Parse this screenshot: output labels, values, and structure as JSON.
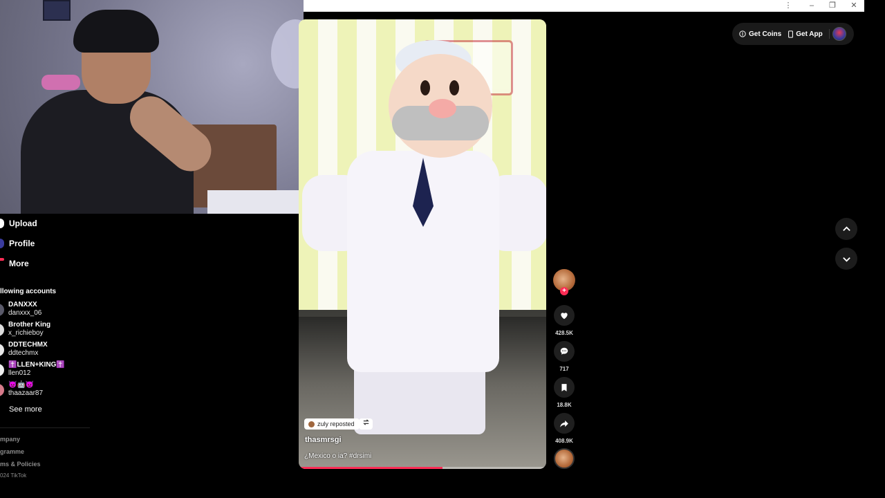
{
  "sidebar": {
    "nav": [
      {
        "label": "Upload",
        "icon": "upload-icon"
      },
      {
        "label": "Profile",
        "icon": "profile-icon"
      },
      {
        "label": "More",
        "icon": "more-icon"
      }
    ],
    "following_title": "llowing accounts",
    "accounts": [
      {
        "name": "DANXXX",
        "username": "danxxx_06"
      },
      {
        "name": "Brother King",
        "username": "x_richieboy"
      },
      {
        "name": "DDTECHMX",
        "username": "ddtechmx"
      },
      {
        "name": "✝️LLEN+KING✝️",
        "username": "llen012"
      },
      {
        "name": "👿🤖👿",
        "username": "thaazaar87"
      }
    ],
    "see_more": "See more",
    "footer": [
      "mpany",
      "gramme",
      "ms & Policies",
      "024 TikTok"
    ]
  },
  "video": {
    "repost_label": "zuly reposted",
    "author": "thasmrsgi",
    "caption": "¿Mexico o ia? #drsimi",
    "progress": 0.58
  },
  "actions": {
    "likes": "428.5K",
    "comments": "717",
    "saves": "18.8K",
    "shares": "408.9K"
  },
  "topbar": {
    "get_coins": "Get Coins",
    "get_app": "Get App"
  },
  "window": {
    "menu": "⋮",
    "minimize": "–",
    "restore": "❐",
    "close": "✕"
  },
  "colors": {
    "accent": "#fe2c55",
    "background": "#000000",
    "button_bg": "#1f1f1f"
  }
}
